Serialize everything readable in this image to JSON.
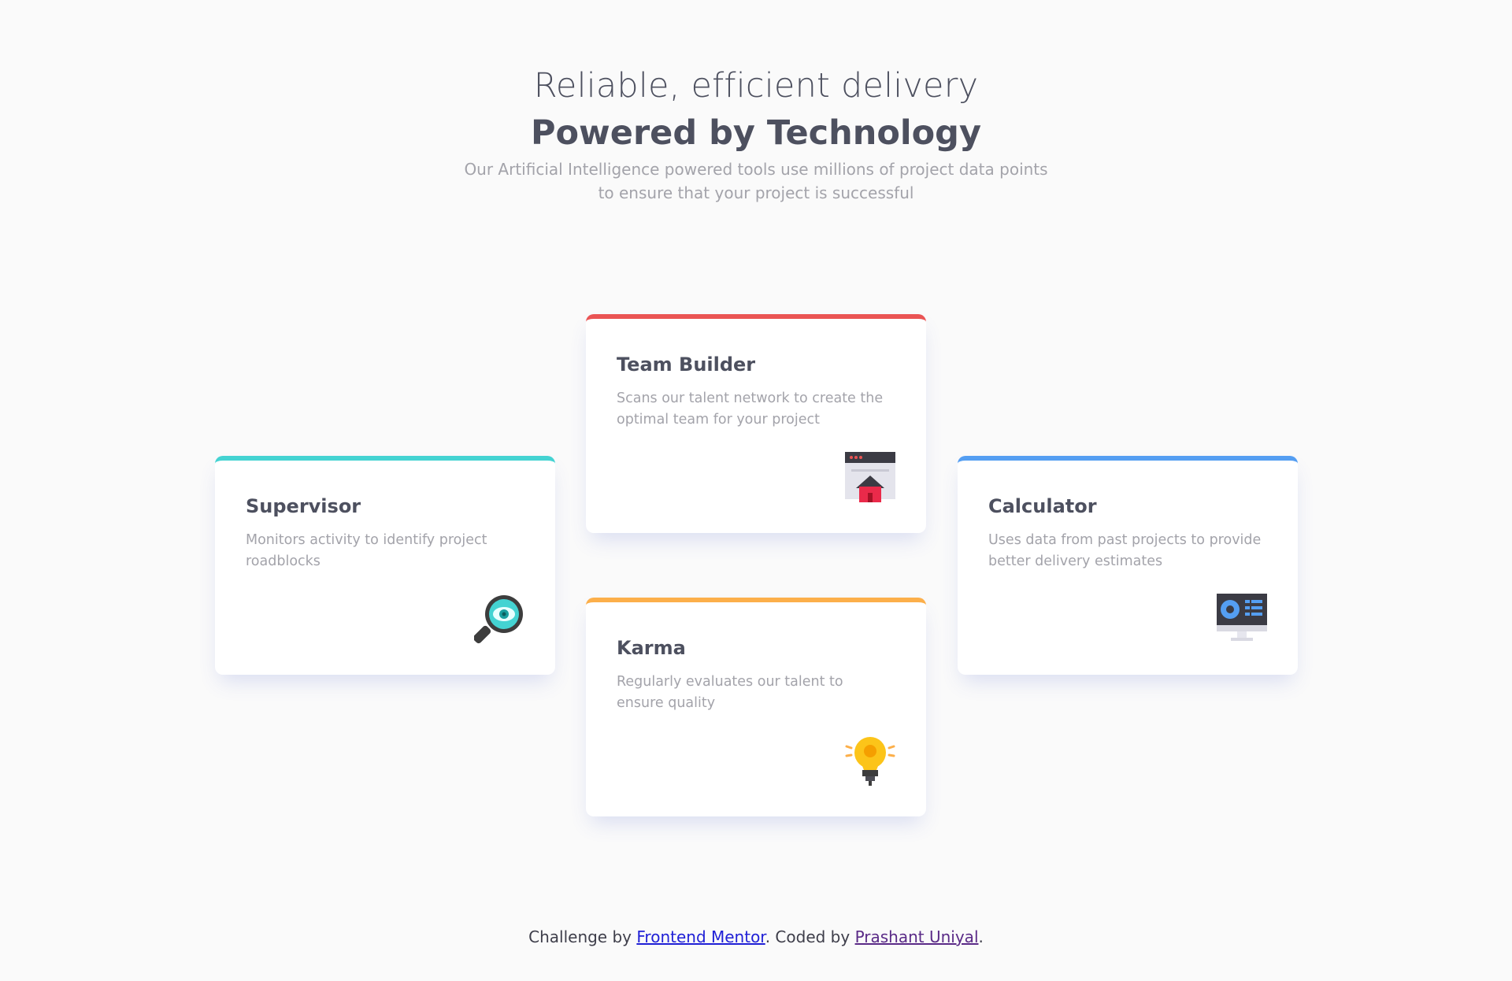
{
  "header": {
    "subtitle": "Reliable, efficient delivery",
    "title": "Powered by Technology",
    "intro_line1": "Our Artificial Intelligence powered tools use millions of project data points",
    "intro_line2": "to ensure that your project is successful"
  },
  "cards": {
    "supervisor": {
      "title": "Supervisor",
      "description": "Monitors activity to identify project roadblocks",
      "icon": "magnifier-eye-icon",
      "accent": "#44d3d2"
    },
    "team_builder": {
      "title": "Team Builder",
      "description": "Scans our talent network to create the optimal team for your project",
      "icon": "browser-house-icon",
      "accent": "#ea5454"
    },
    "karma": {
      "title": "Karma",
      "description": "Regularly evaluates our talent to ensure quality",
      "icon": "lightbulb-icon",
      "accent": "#fcaf4a"
    },
    "calculator": {
      "title": "Calculator",
      "description": "Uses data from past projects to provide better delivery estimates",
      "icon": "monitor-chart-icon",
      "accent": "#549ef2"
    }
  },
  "footer": {
    "prefix": "Challenge by ",
    "mentor_link": "Frontend Mentor",
    "middle": ". Coded by ",
    "author_link": "Prashant Uniyal",
    "suffix": "."
  }
}
